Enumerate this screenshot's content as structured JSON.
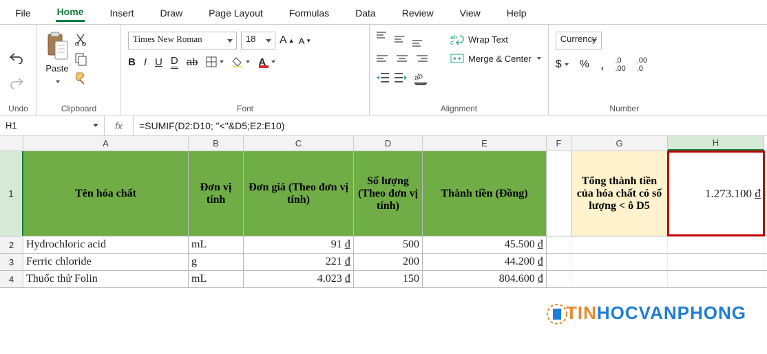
{
  "tabs": [
    "File",
    "Home",
    "Insert",
    "Draw",
    "Page Layout",
    "Formulas",
    "Data",
    "Review",
    "View",
    "Help"
  ],
  "activeTab": 1,
  "ribbon": {
    "undo_label": "Undo",
    "clipboard": {
      "paste": "Paste",
      "label": "Clipboard"
    },
    "font": {
      "name": "Times New Roman",
      "size": "18",
      "label": "Font"
    },
    "align": {
      "wrap": "Wrap Text",
      "merge": "Merge & Center",
      "label": "Alignment"
    },
    "number": {
      "format": "Currency",
      "label": "Number"
    }
  },
  "nameBox": "H1",
  "fxLabel": "fx",
  "formula": "=SUMIF(D2:D10; \"<\"&D5;E2:E10)",
  "cols": [
    "A",
    "B",
    "C",
    "D",
    "E",
    "F",
    "G",
    "H"
  ],
  "rowNums": [
    "1",
    "2",
    "3",
    "4"
  ],
  "headerRow": {
    "A": "Tên hóa chất",
    "B": "Đơn vị tính",
    "C": "Đơn giá (Theo đơn vị tính)",
    "D": "Số lượng (Theo đơn vị tính)",
    "E": "Thành tiền (Đồng)",
    "G": "Tổng thành tiền của hóa chất có số lượng < ô D5",
    "H": "1.273.100 ₫"
  },
  "dataRows": [
    {
      "A": "Hydrochloric acid",
      "B": "mL",
      "C": "91 ₫",
      "D": "500",
      "E": "45.500 ₫"
    },
    {
      "A": "Ferric chloride",
      "B": "g",
      "C": "221 ₫",
      "D": "200",
      "E": "44.200 ₫"
    },
    {
      "A": "Thuốc thử Folin",
      "B": "mL",
      "C": "4.023 ₫",
      "D": "150",
      "E": "804.600 ₫"
    }
  ],
  "chart_data": {
    "type": "table",
    "title": "Hóa chất",
    "columns": [
      "Tên hóa chất",
      "Đơn vị tính",
      "Đơn giá (Theo đơn vị tính)",
      "Số lượng (Theo đơn vị tính)",
      "Thành tiền (Đồng)"
    ],
    "rows": [
      [
        "Hydrochloric acid",
        "mL",
        91,
        500,
        45500
      ],
      [
        "Ferric chloride",
        "g",
        221,
        200,
        44200
      ],
      [
        "Thuốc thử Folin",
        "mL",
        4023,
        150,
        804600
      ]
    ],
    "summary": {
      "label": "Tổng thành tiền của hóa chất có số lượng < ô D5",
      "value": 1273100,
      "formula": "=SUMIF(D2:D10; \"<\"&D5;E2:E10)"
    }
  },
  "watermark": {
    "t1": "TIN",
    "t2": "HOCVANPHONG"
  }
}
